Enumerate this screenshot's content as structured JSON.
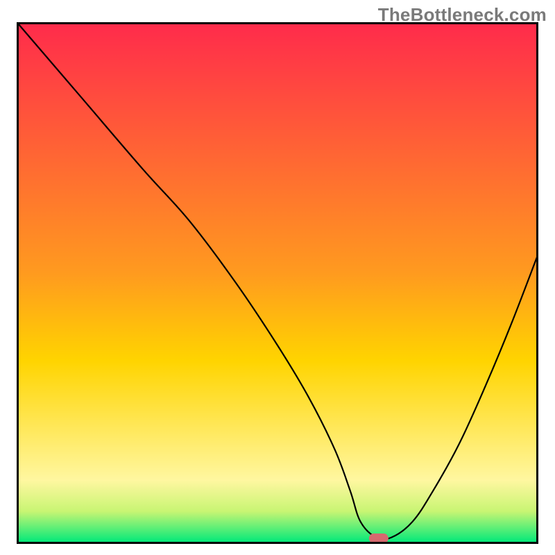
{
  "watermark": "TheBottleneck.com",
  "chart_data": {
    "type": "line",
    "title": "",
    "xlabel": "",
    "ylabel": "",
    "xlim": [
      0,
      100
    ],
    "ylim": [
      0,
      100
    ],
    "grid": false,
    "legend": false,
    "series": [
      {
        "name": "curve",
        "x": [
          0,
          12,
          24,
          33,
          42,
          50,
          56,
          61,
          64,
          66,
          69,
          72,
          76,
          80,
          85,
          90,
          95,
          100
        ],
        "values": [
          100,
          86,
          72,
          62,
          50,
          38,
          28,
          18,
          10,
          4,
          1,
          1,
          4,
          10,
          19,
          30,
          42,
          55
        ]
      }
    ],
    "marker": {
      "x": 69.5,
      "y": 0.8,
      "color": "#d6696f"
    },
    "background_gradient": {
      "top": "#ff2b4b",
      "mid": "#ffd400",
      "bottom": "#00e97a",
      "pale_yellow": "#fff7a0"
    }
  }
}
